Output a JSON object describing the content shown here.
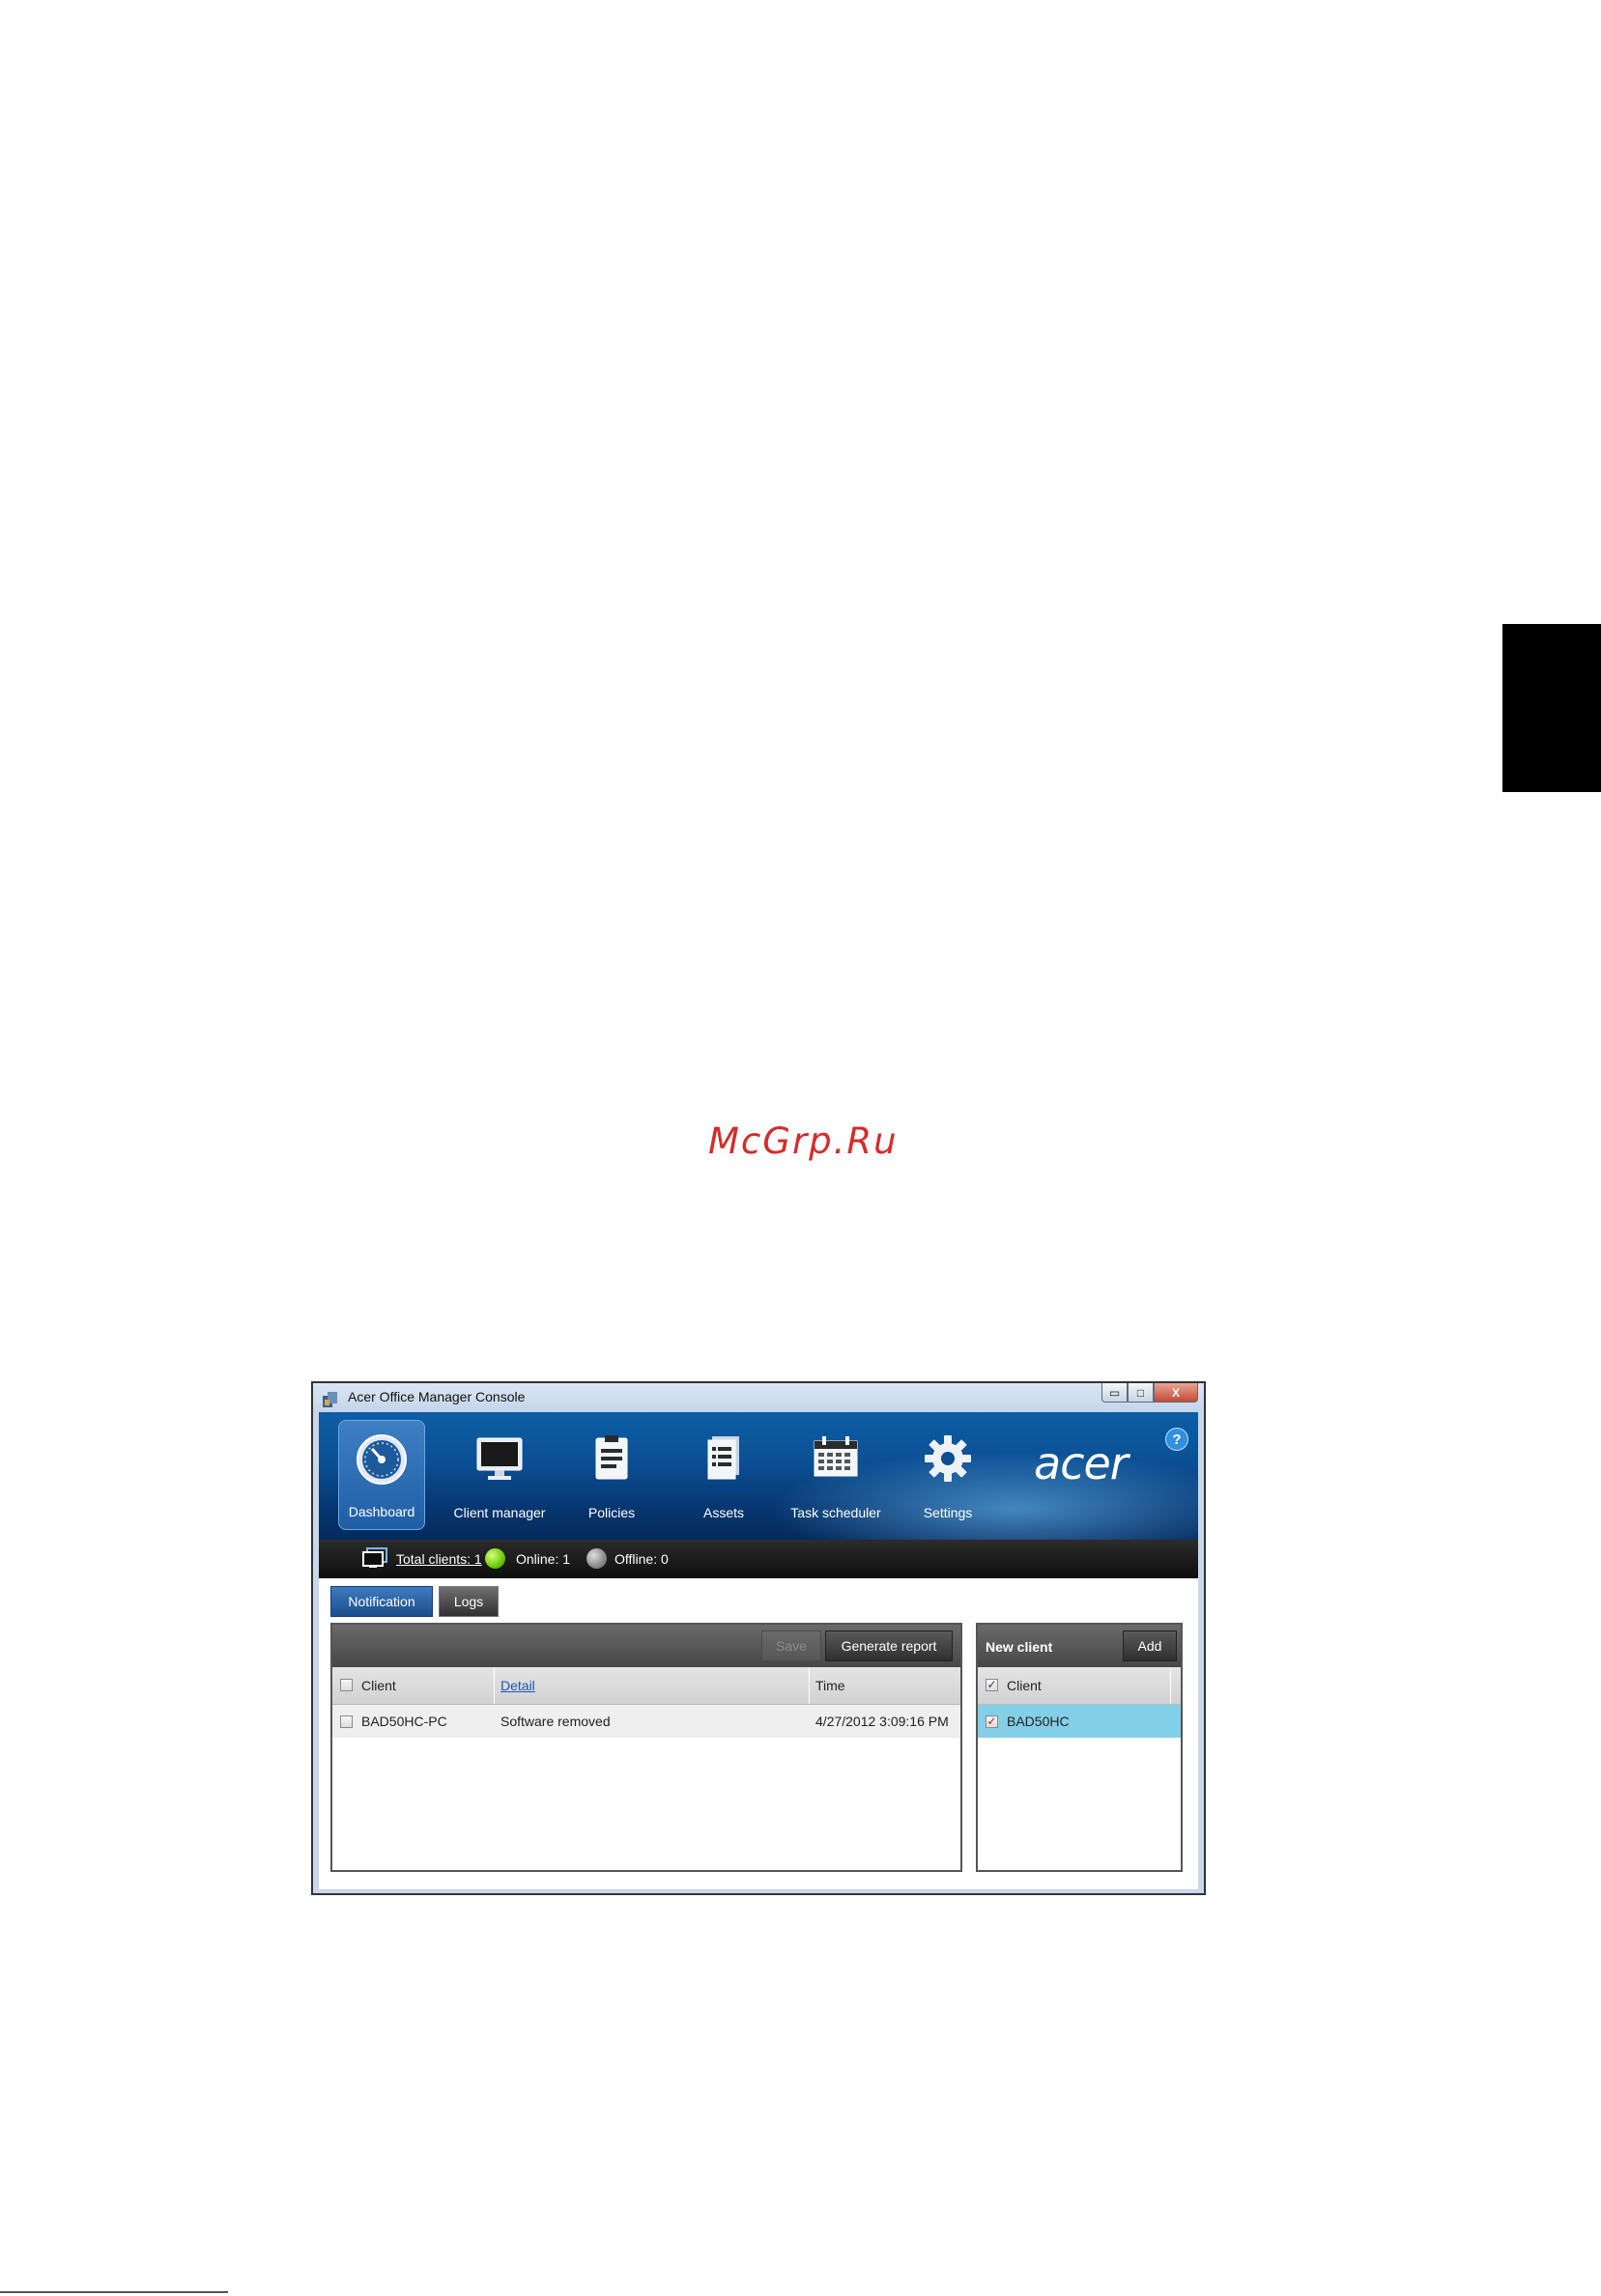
{
  "watermark": "McGrp.Ru",
  "window": {
    "title": "Acer Office Manager Console",
    "controls": {
      "minimize": "▭",
      "maximize": "□",
      "close": "X"
    }
  },
  "nav": {
    "items": [
      {
        "label": "Dashboard",
        "icon": "dashboard-gauge-icon",
        "active": true
      },
      {
        "label": "Client manager",
        "icon": "monitor-icon"
      },
      {
        "label": "Policies",
        "icon": "clipboard-icon"
      },
      {
        "label": "Assets",
        "icon": "document-list-icon"
      },
      {
        "label": "Task scheduler",
        "icon": "calendar-icon"
      },
      {
        "label": "Settings",
        "icon": "gear-icon"
      }
    ],
    "brand": "acer",
    "help": "?"
  },
  "status": {
    "total": "Total clients: 1",
    "online": "Online: 1",
    "offline": "Offline: 0"
  },
  "tabs": {
    "notification": "Notification",
    "logs": "Logs"
  },
  "notifications": {
    "save_label": "Save",
    "report_label": "Generate report",
    "columns": [
      "Client",
      "Detail",
      "Time"
    ],
    "rows": [
      {
        "client": "BAD50HC-PC",
        "detail": "Software removed",
        "time": "4/27/2012 3:09:16 PM"
      }
    ]
  },
  "new_client": {
    "title": "New client",
    "add_label": "Add",
    "column": "Client",
    "rows": [
      {
        "name": "BAD50HC",
        "checked": true
      }
    ]
  },
  "colors": {
    "header_blue": "#0b4f93",
    "selected_row": "#84cfe8",
    "watermark": "#d42c2c"
  }
}
